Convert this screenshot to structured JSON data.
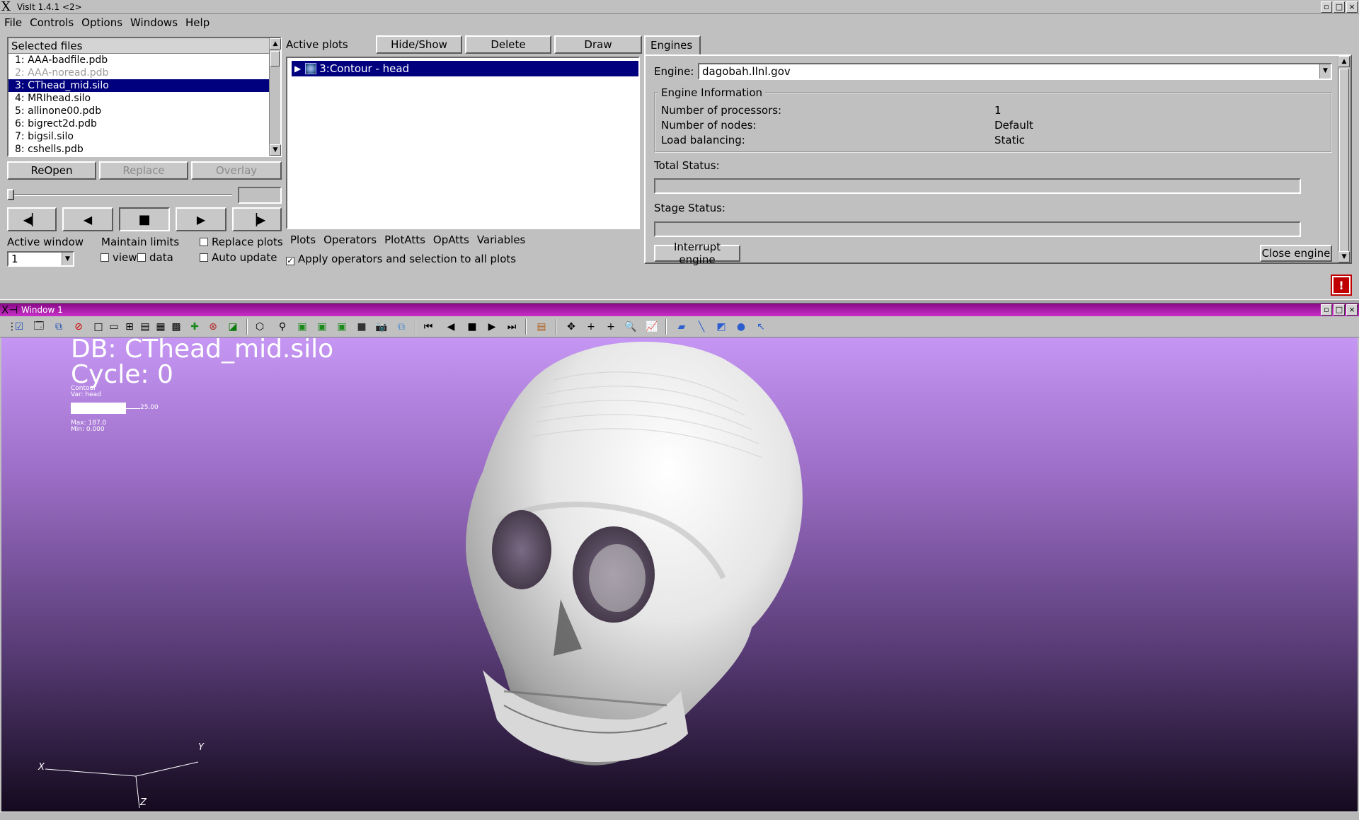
{
  "app": {
    "title": "VisIt 1.4.1 <2>",
    "menu": [
      "File",
      "Controls",
      "Options",
      "Windows",
      "Help"
    ]
  },
  "files": {
    "header": "Selected files",
    "items": [
      {
        "label": "1: AAA-badfile.pdb",
        "state": "normal"
      },
      {
        "label": "2: AAA-noread.pdb",
        "state": "disabled"
      },
      {
        "label": "3: CThead_mid.silo",
        "state": "selected"
      },
      {
        "label": "4: MRIhead.silo",
        "state": "normal"
      },
      {
        "label": "5: allinone00.pdb",
        "state": "normal"
      },
      {
        "label": "6: bigrect2d.pdb",
        "state": "normal"
      },
      {
        "label": "7: bigsil.silo",
        "state": "normal"
      },
      {
        "label": "8: cshells.pdb",
        "state": "normal"
      }
    ],
    "reopen_label": "ReOpen",
    "replace_label": "Replace",
    "overlay_label": "Overlay"
  },
  "window_controls": {
    "active_window_label": "Active window",
    "active_window_value": "1",
    "maintain_limits_label": "Maintain limits",
    "view_label": "view",
    "data_label": "data",
    "replace_plots_label": "Replace plots",
    "auto_update_label": "Auto update"
  },
  "plots": {
    "active_plots_label": "Active plots",
    "hide_show_label": "Hide/Show",
    "delete_label": "Delete",
    "draw_label": "Draw",
    "items": [
      "3:Contour - head"
    ],
    "menus": [
      "Plots",
      "Operators",
      "PlotAtts",
      "OpAtts",
      "Variables"
    ],
    "apply_all_label": "Apply operators and selection to all plots",
    "apply_all_checked": true
  },
  "engines": {
    "tab_label": "Engines",
    "engine_label": "Engine:",
    "engine_value": "dagobah.llnl.gov",
    "info_title": "Engine Information",
    "info": [
      {
        "key": "Number of processors:",
        "value": "1"
      },
      {
        "key": "Number of nodes:",
        "value": "Default"
      },
      {
        "key": "Load balancing:",
        "value": "Static"
      }
    ],
    "total_status_label": "Total Status:",
    "stage_status_label": "Stage Status:",
    "interrupt_label": "Interrupt engine",
    "close_label": "Close engine"
  },
  "viz_window": {
    "title": "Window 1",
    "db_text": "DB: CThead_mid.silo",
    "cycle_text": "Cycle: 0",
    "legend": {
      "plot_type": "Contour",
      "var": "Var: head",
      "level": "25.00",
      "max": "Max:  187.0",
      "min": "Min:  0.000"
    },
    "axes": {
      "x": "X",
      "y": "Y",
      "z": "Z"
    },
    "background_top": "#c596f3",
    "background_bottom": "#140a1e"
  },
  "colors": {
    "selection": "#00007f",
    "window_titlebar": "#b020b0"
  }
}
